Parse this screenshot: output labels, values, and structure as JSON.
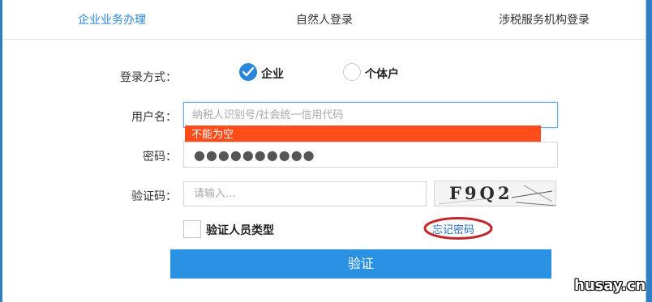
{
  "tabs": [
    {
      "label": "企业业务办理",
      "active": true
    },
    {
      "label": "自然人登录",
      "active": false
    },
    {
      "label": "涉税服务机构登录",
      "active": false
    }
  ],
  "login_method": {
    "label": "登录方式：",
    "options": [
      {
        "label": "企业",
        "selected": true
      },
      {
        "label": "个体户",
        "selected": false
      }
    ]
  },
  "username": {
    "label": "用户名：",
    "placeholder": "纳税人识别号/社会统一信用代码",
    "value": "",
    "error": "不能为空"
  },
  "password": {
    "label": "密码：",
    "value": "●●●●●●●●●●"
  },
  "captcha": {
    "label": "验证码：",
    "placeholder": "请输入...",
    "image_text": "F9Q2"
  },
  "verify_person_type": {
    "label": "验证人员类型",
    "checked": false
  },
  "forgot_password": "忘记密码",
  "submit_label": "验证",
  "watermark": "husay.cn",
  "colors": {
    "accent": "#2a86d8",
    "button": "#2b91e2",
    "error": "#ff4c1a",
    "annotation_circle": "#c0282c"
  }
}
